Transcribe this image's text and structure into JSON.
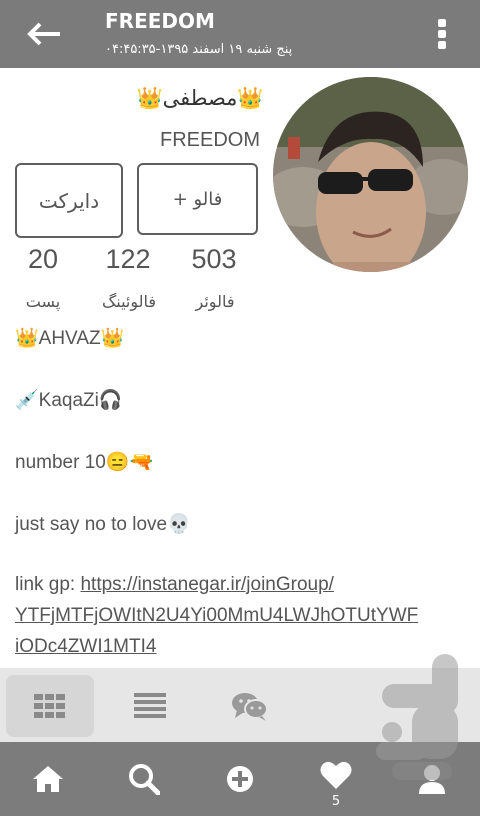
{
  "header": {
    "title": "FREEDOM",
    "datetime": "پنج شنبه ۱۹ اسفند ۱۳۹۵-۰۴:۴۵:۳۵",
    "back_icon": "arrow-left-icon",
    "menu_icon": "more-vertical-icon"
  },
  "profile": {
    "display_name": "👑مصطفی👑",
    "username": "FREEDOM",
    "direct_label": "دایرکت",
    "follow_label": "+ فالو",
    "stats": {
      "followers": {
        "count": "503",
        "label": "فالوئر"
      },
      "following": {
        "count": "122",
        "label": "فالوئینگ"
      },
      "posts": {
        "count": "20",
        "label": "پست"
      }
    }
  },
  "bio": {
    "line1": "👑AHVAZ👑",
    "line2": "💉KaqaZi🎧",
    "line3": "number 10😑🔫",
    "line4": "just say no to love💀",
    "link_prefix": "link gp: ",
    "link_line1": "https://instanegar.ir/joinGroup/",
    "link_line2": "YTFjMTFjOWItN2U4Yi00MmU4LWJhOTUtYWF",
    "link_line3": "iODc4ZWI1MTI4"
  },
  "tabs": [
    "grid-icon",
    "list-icon",
    "chat-icon"
  ],
  "nav": {
    "home": "home-icon",
    "search": "search-icon",
    "add": "add-icon",
    "likes": "heart-icon",
    "likes_badge": "5",
    "profile": "profile-icon"
  },
  "colors": {
    "topbar": "#7b7b7b",
    "bottomnav": "#7c7c7c",
    "tabs_bg": "#e6e6e6",
    "active_tab": "#d6d6d6"
  }
}
